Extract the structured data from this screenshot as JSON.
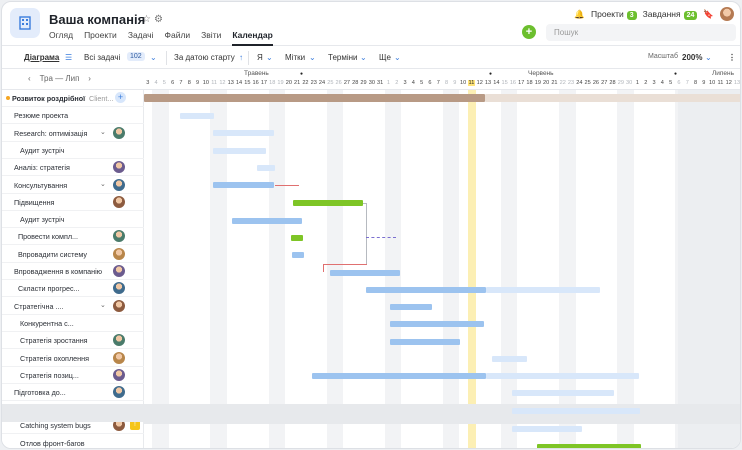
{
  "header": {
    "title": "Ваша компанія",
    "projects_label": "Проекти",
    "projects_count": "3",
    "tasks_label": "Завдання",
    "tasks_count": "24",
    "search_placeholder": "Пошук"
  },
  "nav": [
    "Огляд",
    "Проекти",
    "Задачі",
    "Файли",
    "Звіти",
    "Календар"
  ],
  "toolbar": {
    "view": "Діаграма",
    "filter": "Всі задачі",
    "count": "102",
    "sort": "За датою старту",
    "assignee": "Я",
    "tags": "Мітки",
    "deadlines": "Терміни",
    "more": "Ще",
    "zoom_label": "Масштаб",
    "zoom_value": "200%"
  },
  "timeline": {
    "range": "Тра — Лип",
    "months": [
      "Травень",
      "Червень",
      "Липень"
    ],
    "today": "11",
    "days": [
      "3",
      "4",
      "5",
      "6",
      "7",
      "8",
      "9",
      "10",
      "11",
      "12",
      "13",
      "14",
      "15",
      "16",
      "17",
      "18",
      "19",
      "20",
      "21",
      "22",
      "23",
      "24",
      "25",
      "26",
      "27",
      "28",
      "29",
      "30",
      "31",
      "1",
      "2",
      "3",
      "4",
      "5",
      "6",
      "7",
      "8",
      "9",
      "10",
      "11",
      "12",
      "13",
      "14",
      "15",
      "16",
      "17",
      "18",
      "19",
      "20",
      "21",
      "22",
      "23",
      "24",
      "25",
      "26",
      "27",
      "28",
      "29",
      "30",
      "1",
      "2",
      "3",
      "4",
      "5",
      "6",
      "7",
      "8",
      "9",
      "10",
      "11",
      "12",
      "13",
      "14",
      "15"
    ]
  },
  "tasks": [
    {
      "name": "Розвиток роздрібної",
      "client": "Client...",
      "type": "group"
    },
    {
      "name": "Резюме проекта"
    },
    {
      "name": "Research: оптимізація"
    },
    {
      "name": "Аудит зустріч"
    },
    {
      "name": "Аналіз: стратегія"
    },
    {
      "name": "Консультування"
    },
    {
      "name": "Підвищення"
    },
    {
      "name": "Аудит зустріч"
    },
    {
      "name": "Провести компл..."
    },
    {
      "name": "Впровадити систему"
    },
    {
      "name": "Впровадження в компанію"
    },
    {
      "name": "Скласти прогрес..."
    },
    {
      "name": "Стратегічна ...."
    },
    {
      "name": "Конкурентна с..."
    },
    {
      "name": "Стратегія зростання"
    },
    {
      "name": "Стратегія охоплення"
    },
    {
      "name": "Стратегія позиц..."
    },
    {
      "name": "Підготовка до..."
    },
    {
      "name": "Catching system bugs",
      "badge": "!"
    },
    {
      "name": "Отлов фронт-багов"
    }
  ],
  "colors": {
    "accent": "#3b7ddd",
    "green": "#7ec526",
    "today": "#fcefb4"
  }
}
